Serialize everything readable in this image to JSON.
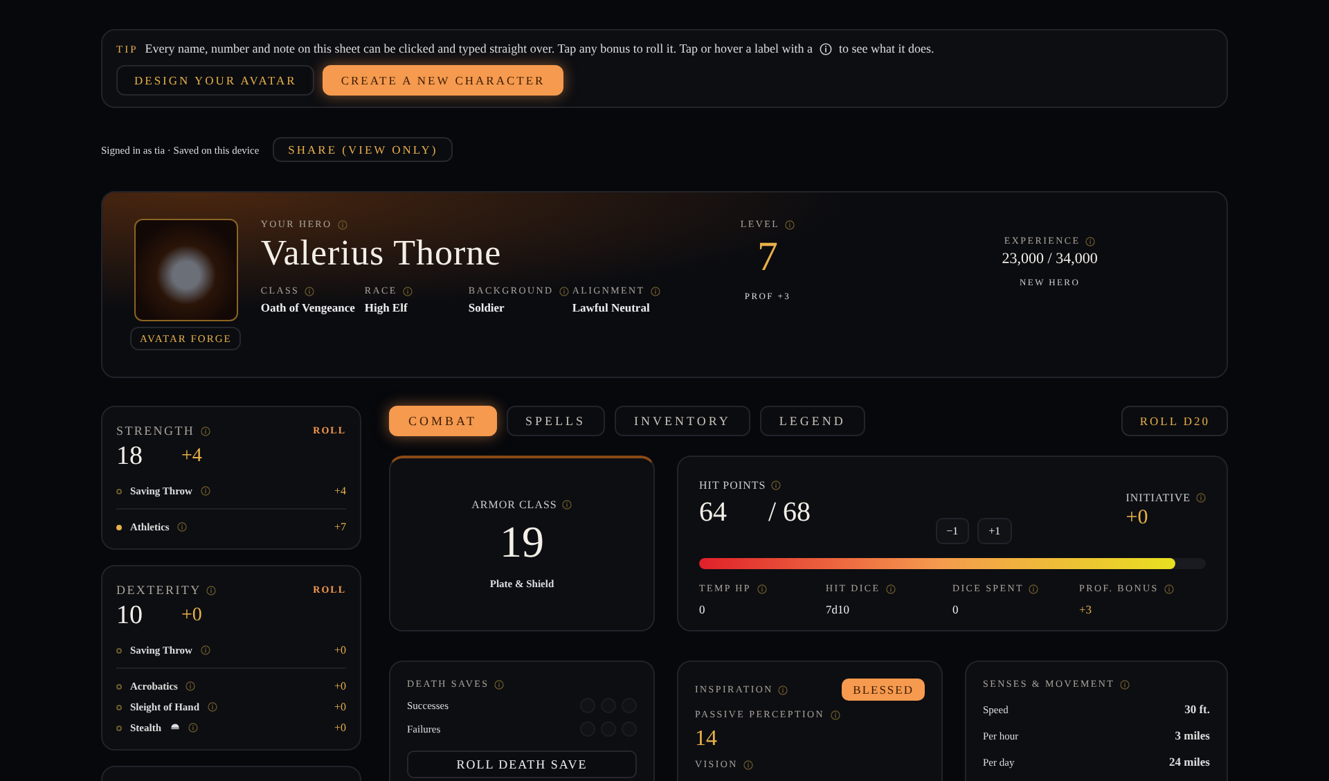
{
  "tip": {
    "label": "TIP",
    "text": "Every name, number and note on this sheet can be clicked and typed straight over. Tap any bonus to roll it. Tap or hover a label with a",
    "text_after": "to see what it does.",
    "buttons": [
      {
        "label": "DESIGN YOUR AVATAR",
        "primary": false
      },
      {
        "label": "CREATE A NEW CHARACTER",
        "primary": true
      }
    ]
  },
  "account": {
    "status": "Signed in as tia · Saved on this device",
    "share": "SHARE (VIEW ONLY)"
  },
  "hero": {
    "avatar_button": "AVATAR FORGE",
    "label": "YOUR HERO",
    "name": "Valerius Thorne",
    "fields": [
      {
        "label": "CLASS",
        "value": "Oath of Vengeance"
      },
      {
        "label": "RACE",
        "value": "High Elf"
      },
      {
        "label": "BACKGROUND",
        "value": "Soldier"
      },
      {
        "label": "ALIGNMENT",
        "value": "Lawful Neutral"
      }
    ],
    "level": {
      "label": "LEVEL",
      "value": "7",
      "prof": "PROF +3"
    },
    "experience": {
      "label": "EXPERIENCE",
      "value": "23,000 / 34,000",
      "note": "NEW HERO"
    }
  },
  "abilities": [
    {
      "name": "STRENGTH",
      "roll": "ROLL",
      "score": "18",
      "modifier": "+4",
      "saving_throw": {
        "label": "Saving Throw",
        "proficient": false,
        "bonus": "+4"
      },
      "skills": [
        {
          "name": "Athletics",
          "proficient": true,
          "disadvantage": false,
          "bonus": "+7"
        }
      ]
    },
    {
      "name": "DEXTERITY",
      "roll": "ROLL",
      "score": "10",
      "modifier": "+0",
      "saving_throw": {
        "label": "Saving Throw",
        "proficient": false,
        "bonus": "+0"
      },
      "skills": [
        {
          "name": "Acrobatics",
          "proficient": false,
          "disadvantage": false,
          "bonus": "+0"
        },
        {
          "name": "Sleight of Hand",
          "proficient": false,
          "disadvantage": false,
          "bonus": "+0"
        },
        {
          "name": "Stealth",
          "proficient": false,
          "disadvantage": true,
          "bonus": "+0"
        }
      ]
    }
  ],
  "tabs": [
    {
      "label": "COMBAT",
      "selected": true
    },
    {
      "label": "SPELLS",
      "selected": false
    },
    {
      "label": "INVENTORY",
      "selected": false
    },
    {
      "label": "LEGEND",
      "selected": false
    }
  ],
  "roll_button": "ROLL D20",
  "armor": {
    "label": "ARMOR CLASS",
    "value": "19",
    "note": "Plate & Shield"
  },
  "hit_points": {
    "label": "HIT POINTS",
    "current": "64",
    "max": "/ 68",
    "minus": "−1",
    "plus": "+1",
    "level": 0.94,
    "initiative": {
      "label": "INITIATIVE",
      "value": "+0"
    },
    "stats": [
      {
        "label": "TEMP HP",
        "value": "0",
        "accent": false
      },
      {
        "label": "HIT DICE",
        "value": "7d10",
        "accent": false
      },
      {
        "label": "DICE SPENT",
        "value": "0",
        "accent": false
      },
      {
        "label": "PROF. BONUS",
        "value": "+3",
        "accent": true
      }
    ]
  },
  "death_saves": {
    "label": "DEATH SAVES",
    "rows": [
      {
        "label": "Successes",
        "marks": [
          {
            "checked": false
          },
          {
            "checked": false
          },
          {
            "checked": false
          }
        ]
      },
      {
        "label": "Failures",
        "marks": [
          {
            "checked": false
          },
          {
            "checked": false
          },
          {
            "checked": false
          }
        ]
      }
    ],
    "button": "ROLL DEATH SAVE"
  },
  "inspiration": {
    "label": "INSPIRATION",
    "badge": "BLESSED",
    "passive_label": "PASSIVE PERCEPTION",
    "passive_value": "14",
    "vision_label": "VISION"
  },
  "senses": {
    "label": "SENSES & MOVEMENT",
    "rows": [
      {
        "label": "Speed",
        "value": "30 ft."
      },
      {
        "label": "Per hour",
        "value": "3 miles"
      },
      {
        "label": "Per day",
        "value": "24 miles"
      }
    ]
  }
}
